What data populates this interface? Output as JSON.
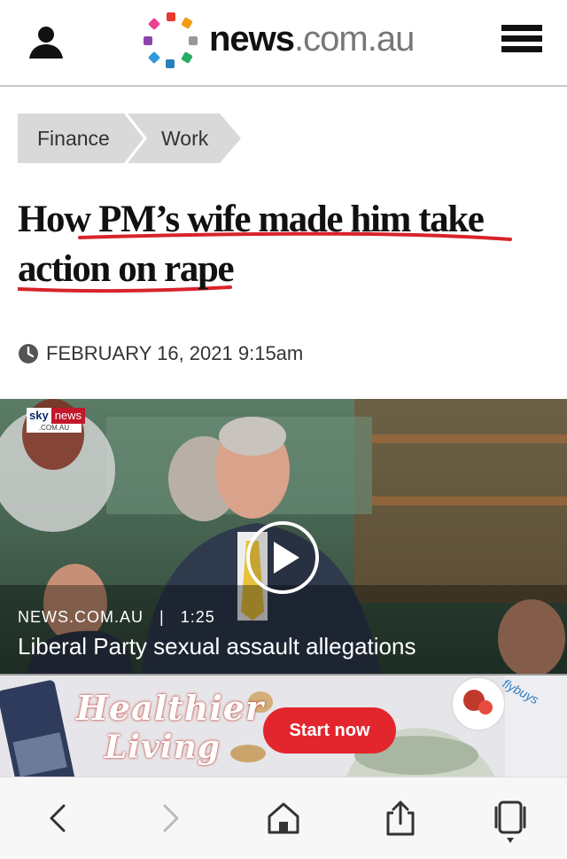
{
  "header": {
    "logo_main": "news",
    "logo_domain": ".com.au"
  },
  "breadcrumb": [
    "Finance",
    "Work"
  ],
  "article": {
    "headline_line1": "How PM’s wife made him take",
    "headline_line2": "action on rape",
    "date": "FEBRUARY 16, 2021 9:15am"
  },
  "video": {
    "channel_top_left": "sky",
    "channel_top_right": "news",
    "channel_sub": ".COM.AU",
    "source": "NEWS.COM.AU",
    "separator": "|",
    "duration": "1:25",
    "title": "Liberal Party sexual assault allegations"
  },
  "ad": {
    "line1": "Healthier",
    "line2": "Living",
    "cta": "Start now",
    "brand": "flybuys"
  },
  "colors": {
    "underline": "#d9232a",
    "cta": "#e3262e",
    "breadcrumb_bg": "#d9d9d9"
  },
  "icons": [
    "user-icon",
    "menu-icon",
    "clock-icon",
    "play-icon",
    "back-icon",
    "forward-icon",
    "home-icon",
    "share-icon",
    "tabs-icon"
  ]
}
